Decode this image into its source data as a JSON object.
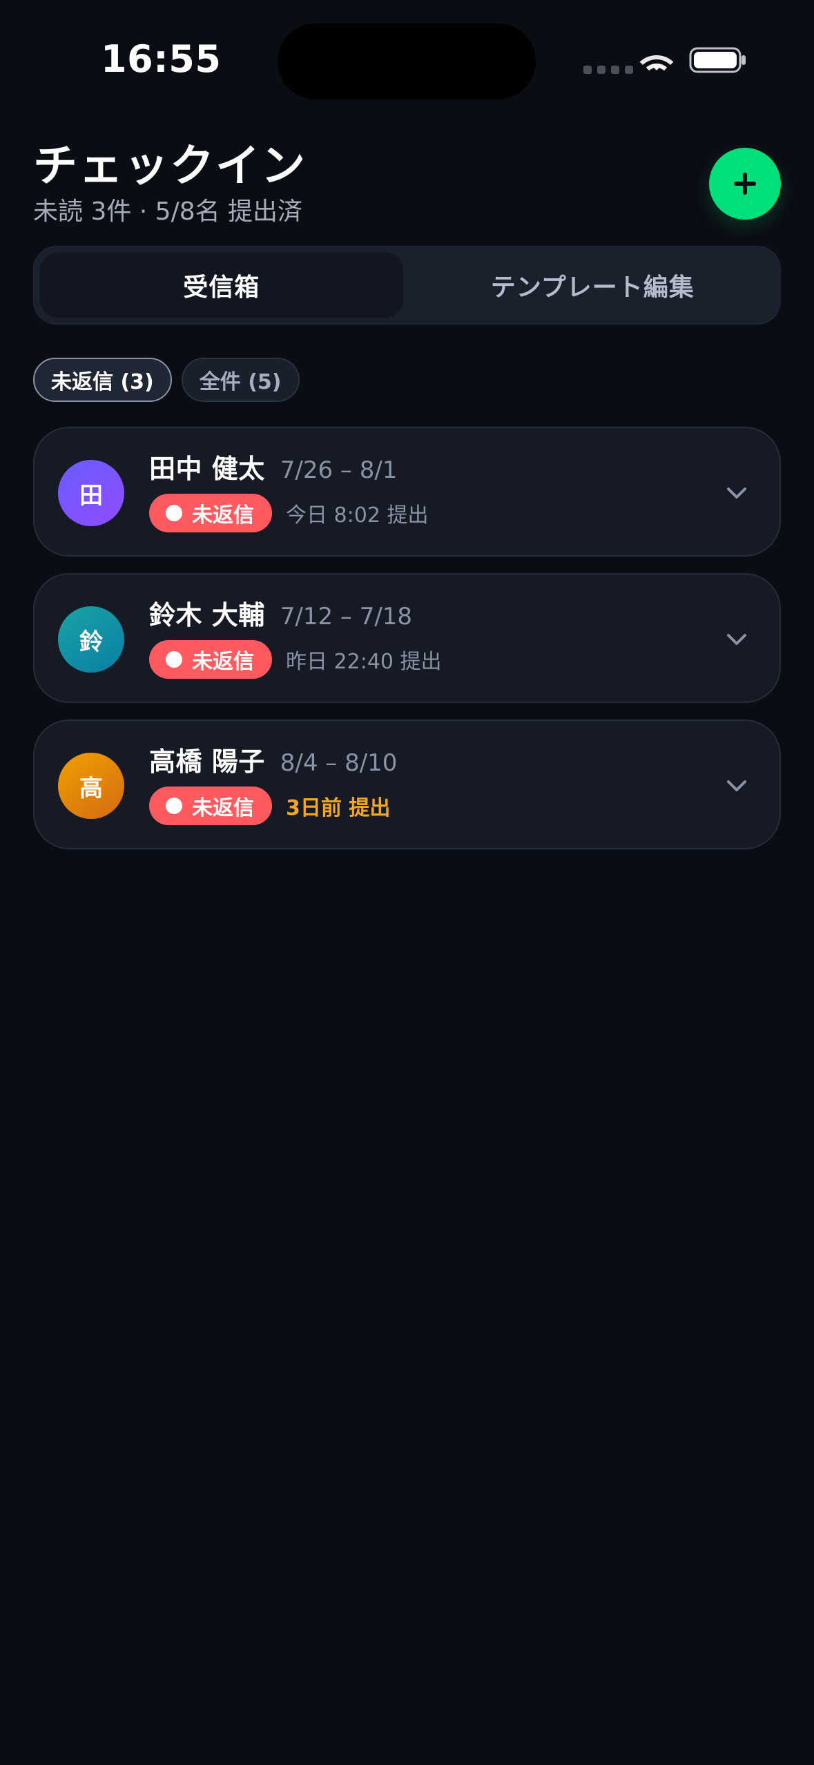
{
  "status_bar": {
    "time": "16:55",
    "icons": [
      "signal-dots-icon",
      "wifi-icon",
      "battery-icon"
    ]
  },
  "header": {
    "title": "チェックイン",
    "subtitle": "未読 3件 · 5/8名 提出済",
    "add_button": {
      "icon": "plus-icon"
    }
  },
  "tabs": [
    {
      "label": "受信箱",
      "active": true
    },
    {
      "label": "テンプレート編集",
      "active": false
    }
  ],
  "filters": [
    {
      "label": "未返信 (3)",
      "active": true
    },
    {
      "label": "全件 (5)",
      "active": false
    }
  ],
  "list": {
    "items": [
      {
        "avatar_text": "田",
        "name": "田中 健太",
        "dates": "7/26 – 8/1",
        "badge": "未返信",
        "submitted": "今日 8:02 提出",
        "submitted_style": "normal"
      },
      {
        "avatar_text": "鈴",
        "name": "鈴木 大輔",
        "dates": "7/12 – 7/18",
        "badge": "未返信",
        "submitted": "昨日 22:40 提出",
        "submitted_style": "normal"
      },
      {
        "avatar_text": "高",
        "name": "高橋 陽子",
        "dates": "8/4 – 8/10",
        "badge": "未返信",
        "submitted": "3日前 提出",
        "submitted_style": "warning"
      }
    ]
  },
  "colors": {
    "background": "#0b0d14",
    "accent": "#00e07a",
    "danger": "#ff5a5f",
    "warning": "#f5a623"
  }
}
